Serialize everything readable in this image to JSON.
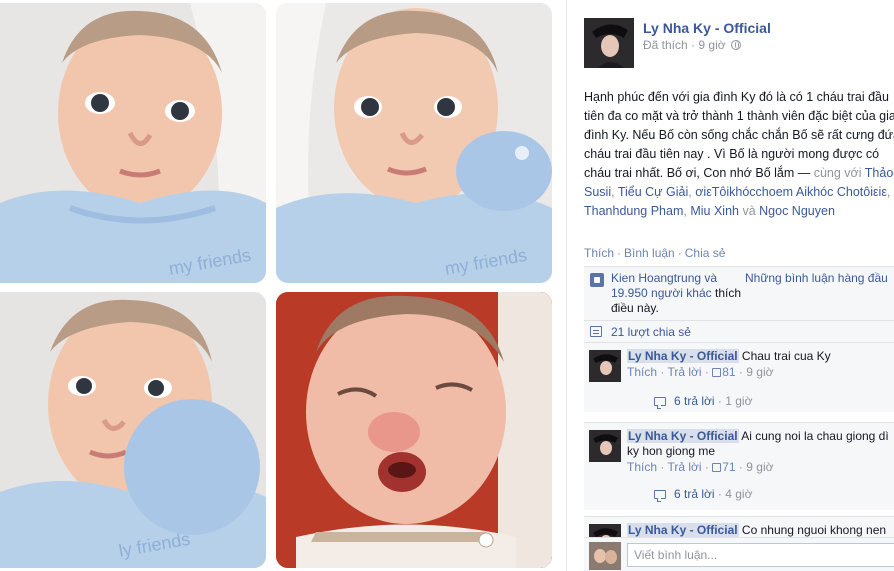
{
  "post": {
    "page_name": "Ly Nha Ky - Official",
    "liked_label": "Đã thích",
    "time": "9 giờ",
    "text_main": "Hạnh phúc đến với gia đình Ky đó là có 1 cháu trai đầu tiên đa co mặt và trở thành 1 thành viên đặc biệt của gia đình Ky. Nếu Bố còn sống chắc chắn Bố sẽ rất cưng đứa cháu trai đầu tiên nay . Vì Bố là người mong được có cháu trai nhất. Bố ơi, Con nhớ Bố lắm —",
    "with_label": "cùng với",
    "tagged": [
      "Thảoo Susii",
      "Tiểu Cự Giải",
      "ơiεTôikhócchoem",
      "Aikhóc Chotôiεiε",
      "Thanhdung Pham",
      "Miu Xinh",
      "Ngoc Nguyen"
    ],
    "and_label": "và"
  },
  "actions": {
    "like": "Thích",
    "comment": "Bình luận",
    "share": "Chia sẻ"
  },
  "likes": {
    "text_before": "Kien Hoangtrung và",
    "others_link": "19.950 người khác",
    "text_after": "thích điều này.",
    "top_comments": "Những bình luận hàng đầu"
  },
  "shares": {
    "text": "21 lượt chia sẻ"
  },
  "comments": [
    {
      "author": "Ly Nha Ky - Official",
      "text": "Chau trai cua Ky",
      "like": "Thích",
      "reply": "Trả lời",
      "likes": "81",
      "time": "9 giờ",
      "replies": "6 trả lời",
      "replies_time": "1 giờ"
    },
    {
      "author": "Ly Nha Ky - Official",
      "text": "Ai cung noi la chau giong dì ky hon giong me",
      "like": "Thích",
      "reply": "Trả lời",
      "likes": "71",
      "time": "9 giờ",
      "replies": "6 trả lời",
      "replies_time": "4 giờ"
    },
    {
      "author": "Ly Nha Ky - Official",
      "text": "Co nhung nguoi khong nen"
    }
  ],
  "composer": {
    "placeholder": "Viết bình luận..."
  },
  "photo_captions": [
    "ly friends",
    "my friends"
  ],
  "colors": {
    "link": "#3b5998",
    "muted": "#90949c",
    "name_highlight": "#d8dfea",
    "baby_clothes": "#b6d0ea"
  }
}
